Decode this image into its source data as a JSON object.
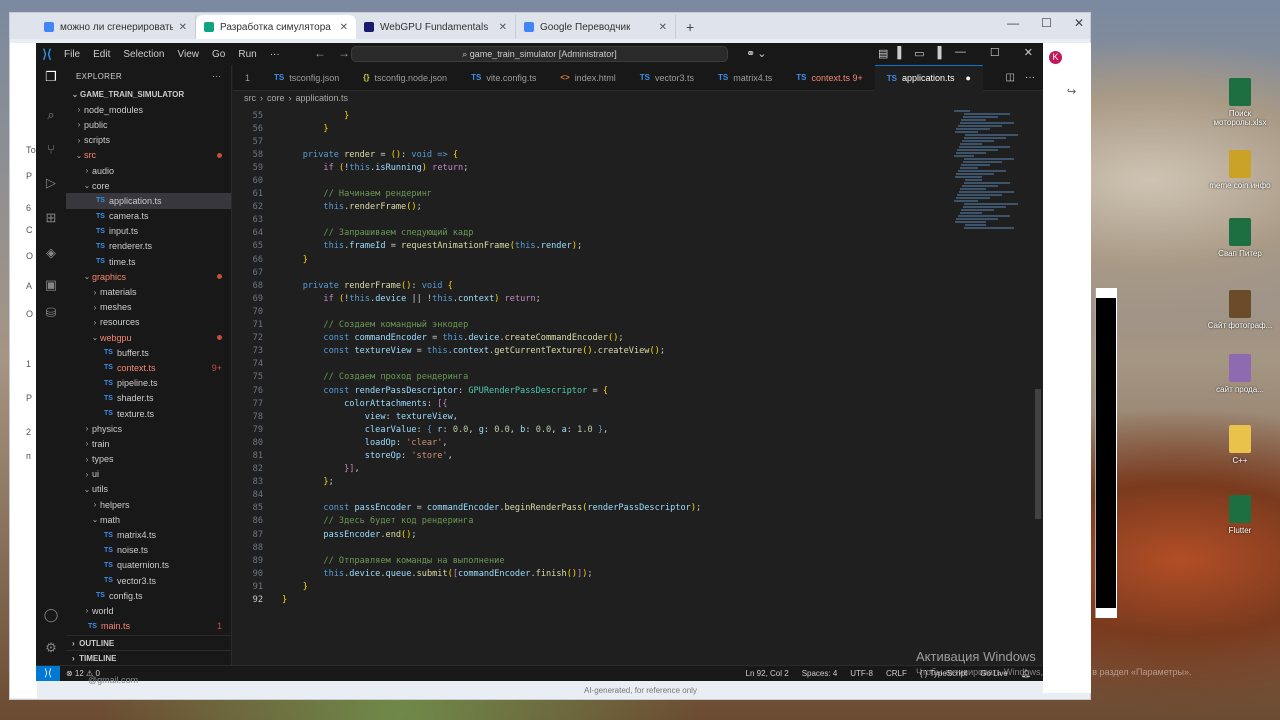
{
  "browser": {
    "tabs": [
      {
        "title": "можно ли сгенерировать лока",
        "color": "#4285f4"
      },
      {
        "title": "Разработка симулятора товар",
        "color": "#10a37f"
      },
      {
        "title": "WebGPU Fundamentals",
        "color": "#1a1a6e"
      },
      {
        "title": "Google Переводчик",
        "color": "#4285f4"
      }
    ],
    "avatar": "K"
  },
  "vscode": {
    "menu": [
      "File",
      "Edit",
      "Selection",
      "View",
      "Go",
      "Run",
      "···"
    ],
    "search": "game_train_simulator [Administrator]",
    "explorer_title": "EXPLORER",
    "root": "GAME_TRAIN_SIMULATOR",
    "tree": [
      {
        "label": "node_modules",
        "kind": "folder",
        "indent": 1,
        "open": false
      },
      {
        "label": "public",
        "kind": "folder",
        "indent": 1,
        "open": false
      },
      {
        "label": "scripts",
        "kind": "folder",
        "indent": 1,
        "open": false
      },
      {
        "label": "src",
        "kind": "folder",
        "indent": 1,
        "open": true,
        "red": true,
        "dot": true
      },
      {
        "label": "audio",
        "kind": "folder",
        "indent": 2,
        "open": false
      },
      {
        "label": "core",
        "kind": "folder",
        "indent": 2,
        "open": true
      },
      {
        "label": "application.ts",
        "kind": "ts",
        "indent": 3,
        "selected": true
      },
      {
        "label": "camera.ts",
        "kind": "ts",
        "indent": 3
      },
      {
        "label": "input.ts",
        "kind": "ts",
        "indent": 3
      },
      {
        "label": "renderer.ts",
        "kind": "ts",
        "indent": 3
      },
      {
        "label": "time.ts",
        "kind": "ts",
        "indent": 3
      },
      {
        "label": "graphics",
        "kind": "folder",
        "indent": 2,
        "open": true,
        "red": true,
        "dot": true
      },
      {
        "label": "materials",
        "kind": "folder",
        "indent": 3,
        "open": false
      },
      {
        "label": "meshes",
        "kind": "folder",
        "indent": 3,
        "open": false
      },
      {
        "label": "resources",
        "kind": "folder",
        "indent": 3,
        "open": false
      },
      {
        "label": "webgpu",
        "kind": "folder",
        "indent": 3,
        "open": true,
        "red": true,
        "dot": true
      },
      {
        "label": "buffer.ts",
        "kind": "ts",
        "indent": 4
      },
      {
        "label": "context.ts",
        "kind": "ts",
        "indent": 4,
        "red": true,
        "count": "9+"
      },
      {
        "label": "pipeline.ts",
        "kind": "ts",
        "indent": 4
      },
      {
        "label": "shader.ts",
        "kind": "ts",
        "indent": 4
      },
      {
        "label": "texture.ts",
        "kind": "ts",
        "indent": 4
      },
      {
        "label": "physics",
        "kind": "folder",
        "indent": 2,
        "open": false
      },
      {
        "label": "train",
        "kind": "folder",
        "indent": 2,
        "open": false
      },
      {
        "label": "types",
        "kind": "folder",
        "indent": 2,
        "open": false
      },
      {
        "label": "ui",
        "kind": "folder",
        "indent": 2,
        "open": false
      },
      {
        "label": "utils",
        "kind": "folder",
        "indent": 2,
        "open": true
      },
      {
        "label": "helpers",
        "kind": "folder",
        "indent": 3,
        "open": false
      },
      {
        "label": "math",
        "kind": "folder",
        "indent": 3,
        "open": true
      },
      {
        "label": "matrix4.ts",
        "kind": "ts",
        "indent": 4
      },
      {
        "label": "noise.ts",
        "kind": "ts",
        "indent": 4
      },
      {
        "label": "quaternion.ts",
        "kind": "ts",
        "indent": 4
      },
      {
        "label": "vector3.ts",
        "kind": "ts",
        "indent": 4
      },
      {
        "label": "config.ts",
        "kind": "ts",
        "indent": 3
      },
      {
        "label": "world",
        "kind": "folder",
        "indent": 2,
        "open": false
      },
      {
        "label": "main.ts",
        "kind": "ts",
        "indent": 2,
        "red": true,
        "count": "1"
      }
    ],
    "outline": "OUTLINE",
    "timeline": "TIMELINE",
    "editor_tabs": [
      {
        "label": "1",
        "icon": ""
      },
      {
        "label": "tsconfig.json",
        "icon": "TS"
      },
      {
        "label": "tsconfig.node.json",
        "icon": "{}"
      },
      {
        "label": "vite.config.ts",
        "icon": "TS"
      },
      {
        "label": "index.html",
        "icon": "<>"
      },
      {
        "label": "vector3.ts",
        "icon": "TS"
      },
      {
        "label": "matrix4.ts",
        "icon": "TS"
      },
      {
        "label": "context.ts 9+",
        "icon": "TS",
        "modified": true
      },
      {
        "label": "application.ts",
        "icon": "TS",
        "active": true
      }
    ],
    "breadcrumb": [
      "src",
      "core",
      "application.ts"
    ],
    "status": {
      "problems": "⊗ 12 ⚠ 0",
      "position": "Ln 92, Col 2",
      "spaces": "Spaces: 4",
      "encoding": "UTF-8",
      "eol": "CRLF",
      "language": "{ } TypeScript",
      "golive": "Go Live"
    }
  },
  "desktop_icons": [
    {
      "label": "Поиск моторолы.xlsx",
      "color": "#1d6f42"
    },
    {
      "label": "meme coin инфо",
      "color": "#c9a227"
    },
    {
      "label": "Свап Питер",
      "color": "#1d6f42"
    },
    {
      "label": "Сайт фотограф...",
      "color": "#6a4b2a"
    },
    {
      "label": "сайт прода...",
      "color": "#8e6bb0"
    },
    {
      "label": "C++",
      "color": "#e8c24a"
    },
    {
      "label": "Flutter",
      "color": "#1d6f42"
    }
  ],
  "left_strip_texts": [
    "То",
    "Р",
    "6",
    "С",
    "О",
    "А",
    "О",
    "1",
    "Р",
    "2",
    "п"
  ],
  "watermark": {
    "line1": "Активация Windows",
    "line2": "Чтобы активировать Windows, перейдите в раздел «Параметры»."
  },
  "ai_note": "AI-generated, for reference only",
  "footer_email": "@gmail.com"
}
